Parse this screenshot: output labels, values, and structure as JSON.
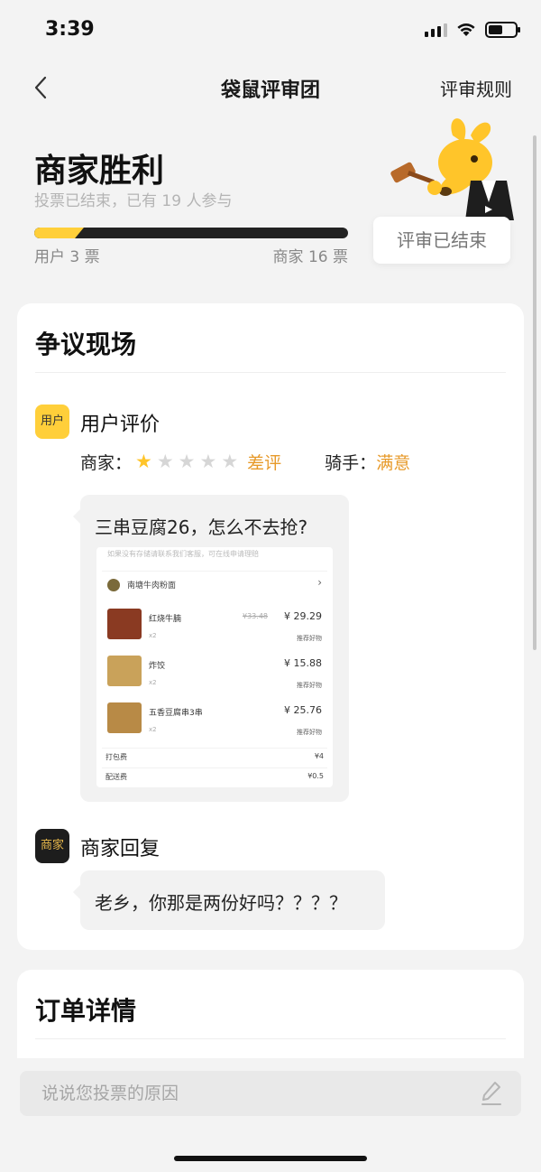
{
  "status_bar": {
    "time": "3:39"
  },
  "nav": {
    "title": "袋鼠评审团",
    "rules": "评审规则"
  },
  "result": {
    "title": "商家胜利",
    "subtitle": "投票已结束，已有 19 人参与",
    "user_votes_label": "用户 3 票",
    "merchant_votes_label": "商家 16 票",
    "user_votes": 3,
    "merchant_votes": 16,
    "status": "评审已结束"
  },
  "dispute": {
    "title": "争议现场",
    "user_tag": "用户",
    "user_heading": "用户评价",
    "merchant_label": "商家：",
    "merchant_stars": 1,
    "merchant_rating": "差评",
    "rider_label": "骑手：",
    "rider_rating": "满意",
    "review_text": "三串豆腐26，怎么不去抢?",
    "merchant_tag": "商家",
    "merchant_heading": "商家回复",
    "reply_text": "老乡，你那是两份好吗？？？？"
  },
  "order_screenshot": {
    "hint": "如果没有存储请联系我们客服，可在线申请理赔",
    "store": "南塘牛肉粉面",
    "items": [
      {
        "name": "红烧牛腩",
        "qty": "x2",
        "price": "¥ 29.29",
        "old_price": "¥33.48",
        "rec": "推荐好物"
      },
      {
        "name": "炸饺",
        "qty": "x2",
        "price": "¥ 15.88",
        "old_price": "",
        "rec": "推荐好物"
      },
      {
        "name": "五香豆腐串3串",
        "qty": "x2",
        "price": "¥ 25.76",
        "old_price": "",
        "rec": "推荐好物"
      }
    ],
    "fees": [
      {
        "label": "打包费",
        "value": "¥4"
      },
      {
        "label": "配送费",
        "value": "¥0.5"
      }
    ]
  },
  "order": {
    "title": "订单详情"
  },
  "comment": {
    "placeholder": "说说您投票的原因"
  },
  "colors": {
    "accent": "#ffcf3a",
    "rating": "#e79a2a",
    "dark": "#222222"
  }
}
